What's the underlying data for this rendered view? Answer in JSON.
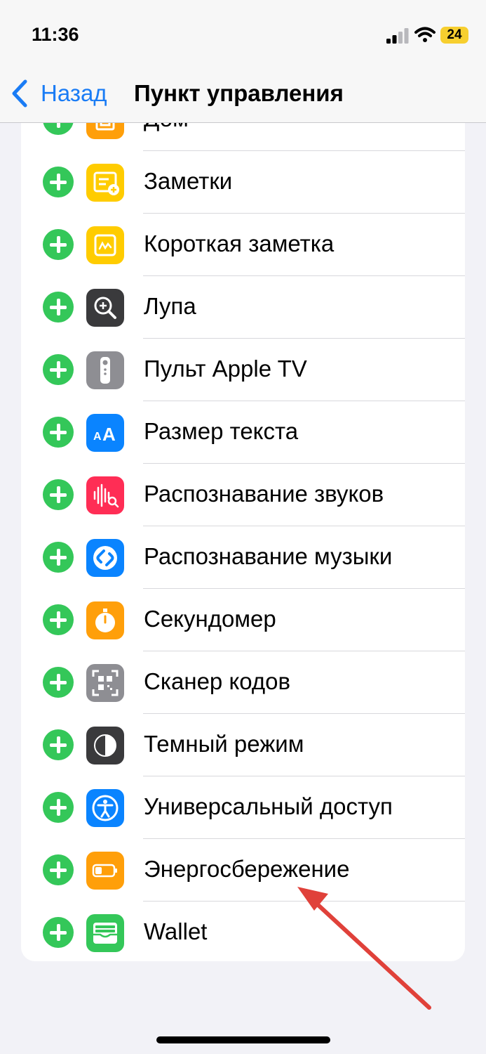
{
  "status_bar": {
    "time": "11:36",
    "battery": "24"
  },
  "nav": {
    "back_label": "Назад",
    "title": "Пункт управления"
  },
  "controls": [
    {
      "label": "Дом",
      "icon": "home-icon",
      "color": "#ff9f0a"
    },
    {
      "label": "Заметки",
      "icon": "notes-icon",
      "color": "#ffcc00"
    },
    {
      "label": "Короткая заметка",
      "icon": "quick-note-icon",
      "color": "#ffcc00"
    },
    {
      "label": "Лупа",
      "icon": "magnifier-icon",
      "color": "#3a3a3c"
    },
    {
      "label": "Пульт Apple TV",
      "icon": "tv-remote-icon",
      "color": "#8e8e93"
    },
    {
      "label": "Размер текста",
      "icon": "text-size-icon",
      "color": "#0a84ff"
    },
    {
      "label": "Распознавание звуков",
      "icon": "sound-recognition-icon",
      "color": "#ff2d55"
    },
    {
      "label": "Распознавание музыки",
      "icon": "shazam-icon",
      "color": "#0a84ff"
    },
    {
      "label": "Секундомер",
      "icon": "stopwatch-icon",
      "color": "#ff9f0a"
    },
    {
      "label": "Сканер кодов",
      "icon": "code-scanner-icon",
      "color": "#8e8e93"
    },
    {
      "label": "Темный режим",
      "icon": "dark-mode-icon",
      "color": "#3a3a3c"
    },
    {
      "label": "Универсальный доступ",
      "icon": "accessibility-icon",
      "color": "#0a84ff"
    },
    {
      "label": "Энергосбережение",
      "icon": "low-power-icon",
      "color": "#ff9f0a"
    },
    {
      "label": "Wallet",
      "icon": "wallet-icon",
      "color": "#34c759"
    }
  ],
  "colors": {
    "accent": "#1a7cf5",
    "add_button": "#34c759",
    "annotation_arrow": "#e0413a"
  }
}
